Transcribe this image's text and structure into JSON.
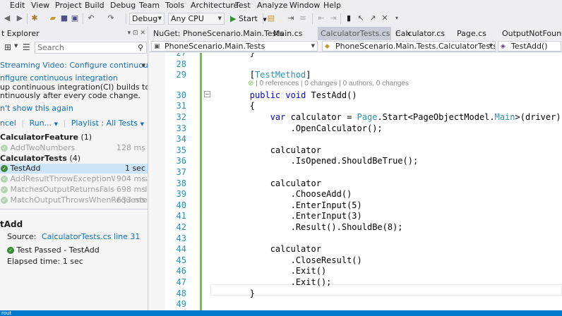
{
  "menu": [
    "Edit",
    "View",
    "Project",
    "Build",
    "Debug",
    "Team",
    "Tools",
    "Architecture",
    "Test",
    "Analyze",
    "Window",
    "Help"
  ],
  "toolbar": {
    "config": "Debug",
    "platform": "Any CPU",
    "start_label": "Start"
  },
  "explorer": {
    "title": "t Explorer",
    "search_placeholder": "Search",
    "banner_title": "Streaming Video: Configure continuous integratio",
    "banner_link": "nfigure continuous integration",
    "banner_text_1": "up continuous integration(CI) builds to test",
    "banner_text_2": "ntinuously after every code change.",
    "dont_show": "n't show this again",
    "cancel": "ncel",
    "run": "Run...",
    "playlist": "Playlist : All Tests",
    "group1": {
      "name": "CalculatorFeature",
      "count": "(1)"
    },
    "group1_tests": [
      {
        "name": "AddTwoNumbers",
        "duration": "128 ms"
      }
    ],
    "group2": {
      "name": "CalculatorTests",
      "count": "(4)"
    },
    "group2_tests": [
      {
        "name": "TestAdd",
        "duration": "1 sec"
      },
      {
        "name": "AddResultThrowExceptionWhenResult...",
        "duration": "904 ms"
      },
      {
        "name": "MatchesOutputReturnsFalseWhenNoEx...",
        "duration": "698 ms"
      },
      {
        "name": "MatchOutputThrowsWhenRequested",
        "duration": "633 ms"
      }
    ],
    "detail": {
      "title": "tAdd",
      "source_label": "Source:",
      "source_link": "CalculatorTests.cs line 31",
      "result": "Test Passed - TestAdd",
      "elapsed": "Elapsed time: 1 sec"
    }
  },
  "tabs": [
    {
      "label": "NuGet: PhoneScenario.Main.Tests",
      "active": false
    },
    {
      "label": "Main.cs",
      "active": false
    },
    {
      "label": "CalculatorTests.cs",
      "active": true
    },
    {
      "label": "Calculator.cs",
      "active": false
    },
    {
      "label": "Page.cs",
      "active": false
    },
    {
      "label": "OutputNotFoundExce",
      "active": false
    }
  ],
  "nav": {
    "project": "PhoneScenario.Main.Tests",
    "class": "PhoneScenario.Main.Tests.CalculatorTests",
    "member": "TestAdd()"
  },
  "editor": {
    "lens": "| 0 references | 0 changes | 0 authors, 0 changes",
    "lines": [
      {
        "n": "27",
        "text": "        }"
      },
      {
        "n": "28",
        "text": ""
      },
      {
        "n": "29",
        "text": "        [TestMethod]"
      },
      {
        "n": "30",
        "text": "        public void TestAdd()"
      },
      {
        "n": "31",
        "text": "        {"
      },
      {
        "n": "32",
        "text": "            var calculator = Page.Start<PageObjectModel.Main>(driver)"
      },
      {
        "n": "33",
        "text": "                .OpenCalculator();"
      },
      {
        "n": "34",
        "text": ""
      },
      {
        "n": "35",
        "text": "            calculator"
      },
      {
        "n": "36",
        "text": "                .IsOpened.ShouldBeTrue();"
      },
      {
        "n": "37",
        "text": ""
      },
      {
        "n": "38",
        "text": "            calculator"
      },
      {
        "n": "39",
        "text": "                .ChooseAdd()"
      },
      {
        "n": "40",
        "text": "                .EnterInput(5)"
      },
      {
        "n": "41",
        "text": "                .EnterInput(3)"
      },
      {
        "n": "42",
        "text": "                .Result().ShouldBe(8);"
      },
      {
        "n": "43",
        "text": ""
      },
      {
        "n": "44",
        "text": "            calculator"
      },
      {
        "n": "45",
        "text": "                .CloseResult()"
      },
      {
        "n": "46",
        "text": "                .Exit()"
      },
      {
        "n": "47",
        "text": "                .Exit();"
      },
      {
        "n": "48",
        "text": "        }"
      },
      {
        "n": "49",
        "text": ""
      }
    ]
  },
  "status": "rout"
}
